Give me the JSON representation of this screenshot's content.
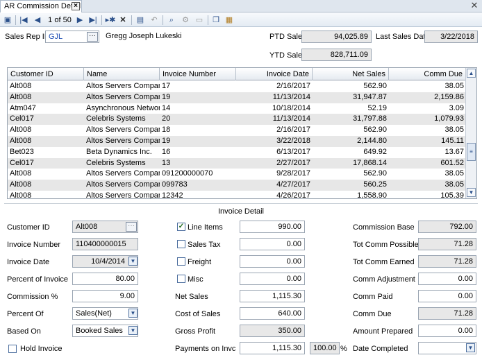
{
  "tab": {
    "title": "AR Commission Detail"
  },
  "toolbar": {
    "record_position": "1 of 50"
  },
  "header": {
    "sales_rep_label": "Sales Rep ID",
    "sales_rep_value": "GJL",
    "sales_rep_name": "Gregg Joseph Lukeski",
    "ptd_sales_label": "PTD Sales",
    "ptd_sales_value": "94,025.89",
    "last_sales_date_label": "Last Sales Date",
    "last_sales_date_value": "3/22/2018",
    "ytd_sales_label": "YTD Sales",
    "ytd_sales_value": "828,711.09"
  },
  "grid": {
    "columns": [
      "Customer ID",
      "Name",
      "Invoice Number",
      "Invoice Date",
      "Net Sales",
      "Comm Due"
    ],
    "rows": [
      [
        "Alt008",
        "Altos Servers Company",
        "17",
        "2/16/2017",
        "562.90",
        "38.05"
      ],
      [
        "Alt008",
        "Altos Servers Company",
        "19",
        "11/13/2014",
        "31,947.87",
        "2,159.86"
      ],
      [
        "Atm047",
        "Asynchronous Networki...",
        "14",
        "10/18/2014",
        "52.19",
        "3.09"
      ],
      [
        "Cel017",
        "Celebris Systems",
        "20",
        "11/13/2014",
        "31,797.88",
        "1,079.93"
      ],
      [
        "Alt008",
        "Altos Servers Company",
        "18",
        "2/16/2017",
        "562.90",
        "38.05"
      ],
      [
        "Alt008",
        "Altos Servers Company",
        "19",
        "3/22/2018",
        "2,144.80",
        "145.11"
      ],
      [
        "Bet023",
        "Beta Dynamics Inc.",
        "16",
        "6/13/2017",
        "649.92",
        "13.67"
      ],
      [
        "Cel017",
        "Celebris Systems",
        "13",
        "2/27/2017",
        "17,868.14",
        "601.52"
      ],
      [
        "Alt008",
        "Altos Servers Company",
        "091200000070",
        "9/28/2017",
        "562.90",
        "38.05"
      ],
      [
        "Alt008",
        "Altos Servers Company",
        "099783",
        "4/27/2017",
        "560.25",
        "38.05"
      ],
      [
        "Alt008",
        "Altos Servers Company",
        "12342",
        "4/26/2017",
        "1,558.90",
        "105.39"
      ]
    ]
  },
  "detail": {
    "title": "Invoice Detail",
    "customer_id_label": "Customer ID",
    "customer_id_value": "Alt008",
    "invoice_number_label": "Invoice Number",
    "invoice_number_value": "110400000015",
    "invoice_date_label": "Invoice Date",
    "invoice_date_value": "10/4/2014",
    "percent_of_invoice_label": "Percent of Invoice",
    "percent_of_invoice_value": "80.00",
    "commission_pct_label": "Commission %",
    "commission_pct_value": "9.00",
    "percent_of_label": "Percent Of",
    "percent_of_value": "Sales(Net)",
    "based_on_label": "Based On",
    "based_on_value": "Booked Sales",
    "hold_invoice_label": "Hold Invoice",
    "line_items_label": "Line Items",
    "line_items_value": "990.00",
    "sales_tax_label": "Sales Tax",
    "sales_tax_value": "0.00",
    "freight_label": "Freight",
    "freight_value": "0.00",
    "misc_label": "Misc",
    "misc_value": "0.00",
    "net_sales_label": "Net Sales",
    "net_sales_value": "1,115.30",
    "cost_of_sales_label": "Cost of Sales",
    "cost_of_sales_value": "640.00",
    "gross_profit_label": "Gross Profit",
    "gross_profit_value": "350.00",
    "payments_on_inv_label": "Payments on Invc",
    "payments_on_inv_value": "1,115.30",
    "payments_pct_value": "100.00",
    "pct_symbol": "%",
    "commission_base_label": "Commission Base",
    "commission_base_value": "792.00",
    "tot_comm_possible_label": "Tot Comm Possible",
    "tot_comm_possible_value": "71.28",
    "tot_comm_earned_label": "Tot Comm Earned",
    "tot_comm_earned_value": "71.28",
    "comm_adjustment_label": "Comm Adjustment",
    "comm_adjustment_value": "0.00",
    "comm_paid_label": "Comm Paid",
    "comm_paid_value": "0.00",
    "comm_due_label": "Comm Due",
    "comm_due_value": "71.28",
    "amount_prepared_label": "Amount Prepared",
    "amount_prepared_value": "0.00",
    "date_completed_label": "Date Completed",
    "date_completed_value": ""
  }
}
